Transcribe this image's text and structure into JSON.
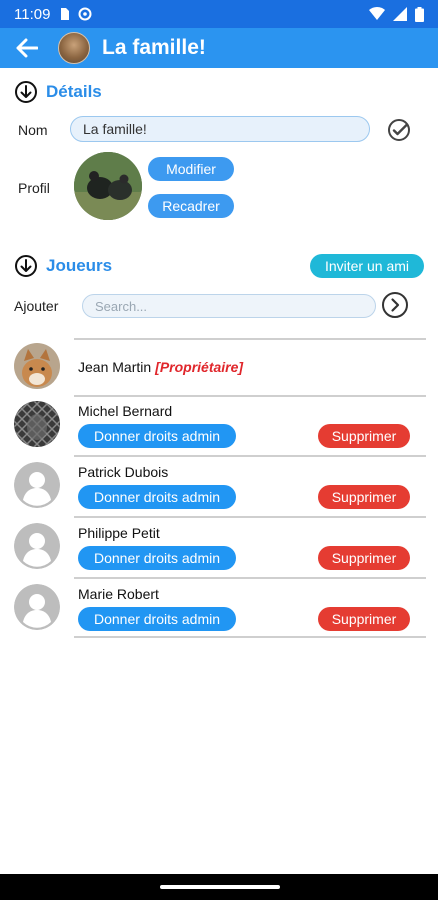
{
  "status": {
    "time": "11:09"
  },
  "app_bar": {
    "title": "La famille!"
  },
  "details": {
    "section_title": "Détails",
    "name_label": "Nom",
    "name_value": "La famille!",
    "profile_label": "Profil",
    "modify_label": "Modifier",
    "crop_label": "Recadrer"
  },
  "players": {
    "section_title": "Joueurs",
    "invite_label": "Inviter un ami",
    "add_label": "Ajouter",
    "search_placeholder": "Search...",
    "owner": {
      "name": "Jean Martin",
      "tag": "[Propriétaire]"
    },
    "members": [
      {
        "name": "Michel Bernard",
        "admin_label": "Donner droits admin",
        "delete_label": "Supprimer"
      },
      {
        "name": "Patrick Dubois",
        "admin_label": "Donner droits admin",
        "delete_label": "Supprimer"
      },
      {
        "name": "Philippe Petit",
        "admin_label": "Donner droits admin",
        "delete_label": "Supprimer"
      },
      {
        "name": "Marie Robert",
        "admin_label": "Donner droits admin",
        "delete_label": "Supprimer"
      }
    ]
  },
  "colors": {
    "status_bar": "#1a6fe0",
    "app_bar": "#2b94f0",
    "section_title": "#2b8de8",
    "pill_button": "#3d9af0",
    "invite_button": "#1fb8d8",
    "admin_button": "#2196f3",
    "delete_button": "#e53c32",
    "owner_tag": "#e0262b"
  },
  "icons": {
    "back": "arrow-left-icon",
    "section": "arrow-down-circle-icon",
    "confirm": "check-circle-icon",
    "go": "chevron-right-circle-icon",
    "default_avatar": "person-icon"
  }
}
